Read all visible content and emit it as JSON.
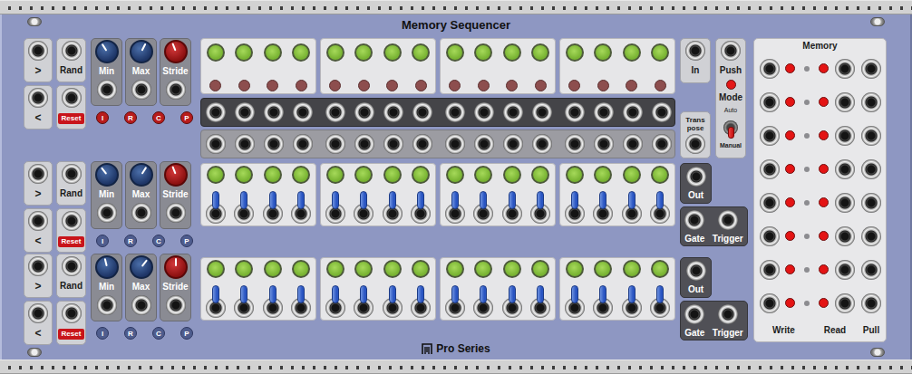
{
  "title": "Memory Sequencer",
  "footer": "Pro Series",
  "rows": [
    {
      "next": ">",
      "prev": "<",
      "rand": "Rand",
      "reset": "Reset",
      "knobs": [
        {
          "label": "Min",
          "level": 0.38,
          "kind": "blue"
        },
        {
          "label": "Max",
          "level": 0.6,
          "kind": "blue"
        },
        {
          "label": "Stride",
          "level": 0.42,
          "kind": "red"
        }
      ],
      "indicators": [
        {
          "label": "I",
          "on": true
        },
        {
          "label": "R",
          "on": true
        },
        {
          "label": "C",
          "on": true
        },
        {
          "label": "P",
          "on": true
        }
      ],
      "kind": "light",
      "steps": [
        {
          "on": false
        },
        {
          "on": false
        },
        {
          "on": false
        },
        {
          "on": false
        },
        {
          "on": false
        },
        {
          "on": false
        },
        {
          "on": false
        },
        {
          "on": false
        },
        {
          "on": false
        },
        {
          "on": false
        },
        {
          "on": false
        },
        {
          "on": false
        },
        {
          "on": false
        },
        {
          "on": false
        },
        {
          "on": false
        },
        {
          "on": false
        }
      ]
    },
    {
      "next": ">",
      "prev": "<",
      "rand": "Rand",
      "reset": "Reset",
      "knobs": [
        {
          "label": "Min",
          "level": 0.36,
          "kind": "blue"
        },
        {
          "label": "Max",
          "level": 0.62,
          "kind": "blue"
        },
        {
          "label": "Stride",
          "level": 0.42,
          "kind": "red"
        }
      ],
      "indicators": [
        {
          "label": "I",
          "on": false
        },
        {
          "label": "R",
          "on": false
        },
        {
          "label": "C",
          "on": false
        },
        {
          "label": "P",
          "on": false
        }
      ],
      "kind": "switch",
      "steps": [
        {
          "up": true
        },
        {
          "up": true
        },
        {
          "up": true
        },
        {
          "up": true
        },
        {
          "up": true
        },
        {
          "up": true
        },
        {
          "up": true
        },
        {
          "up": true
        },
        {
          "up": true
        },
        {
          "up": true
        },
        {
          "up": true
        },
        {
          "up": true
        },
        {
          "up": true
        },
        {
          "up": true
        },
        {
          "up": true
        },
        {
          "up": true
        }
      ]
    },
    {
      "next": ">",
      "prev": "<",
      "rand": "Rand",
      "reset": "Reset",
      "knobs": [
        {
          "label": "Min",
          "level": 0.45,
          "kind": "blue"
        },
        {
          "label": "Max",
          "level": 0.64,
          "kind": "blue"
        },
        {
          "label": "Stride",
          "level": 0.5,
          "kind": "red"
        }
      ],
      "indicators": [
        {
          "label": "I",
          "on": false
        },
        {
          "label": "R",
          "on": false
        },
        {
          "label": "C",
          "on": false
        },
        {
          "label": "P",
          "on": false
        }
      ],
      "kind": "switch",
      "steps": [
        {
          "up": true
        },
        {
          "up": true
        },
        {
          "up": true
        },
        {
          "up": true
        },
        {
          "up": true
        },
        {
          "up": true
        },
        {
          "up": true
        },
        {
          "up": true
        },
        {
          "up": true
        },
        {
          "up": true
        },
        {
          "up": true
        },
        {
          "up": true
        },
        {
          "up": true
        },
        {
          "up": true
        },
        {
          "up": true
        },
        {
          "up": true
        }
      ]
    }
  ],
  "input": {
    "in": "In",
    "transpose": "Trans pose",
    "push": "Push",
    "push_light_on": true,
    "mode": "Mode",
    "mode_options": [
      {
        "label": "Auto",
        "selected": false
      },
      {
        "label": "Manual",
        "selected": true
      }
    ]
  },
  "outputs": [
    {
      "out": "Out",
      "gate": "Gate",
      "trigger": "Trigger"
    },
    {
      "out": "Out",
      "gate": "Gate",
      "trigger": "Trigger"
    }
  ],
  "memory": {
    "title": "Memory",
    "slots": [
      {
        "write_on": true,
        "read_on": true
      },
      {
        "write_on": true,
        "read_on": true
      },
      {
        "write_on": true,
        "read_on": true
      },
      {
        "write_on": true,
        "read_on": true
      },
      {
        "write_on": true,
        "read_on": true
      },
      {
        "write_on": true,
        "read_on": true
      },
      {
        "write_on": true,
        "read_on": true
      },
      {
        "write_on": true,
        "read_on": true
      }
    ],
    "labels": [
      "Write",
      "Read",
      "Pull"
    ]
  }
}
